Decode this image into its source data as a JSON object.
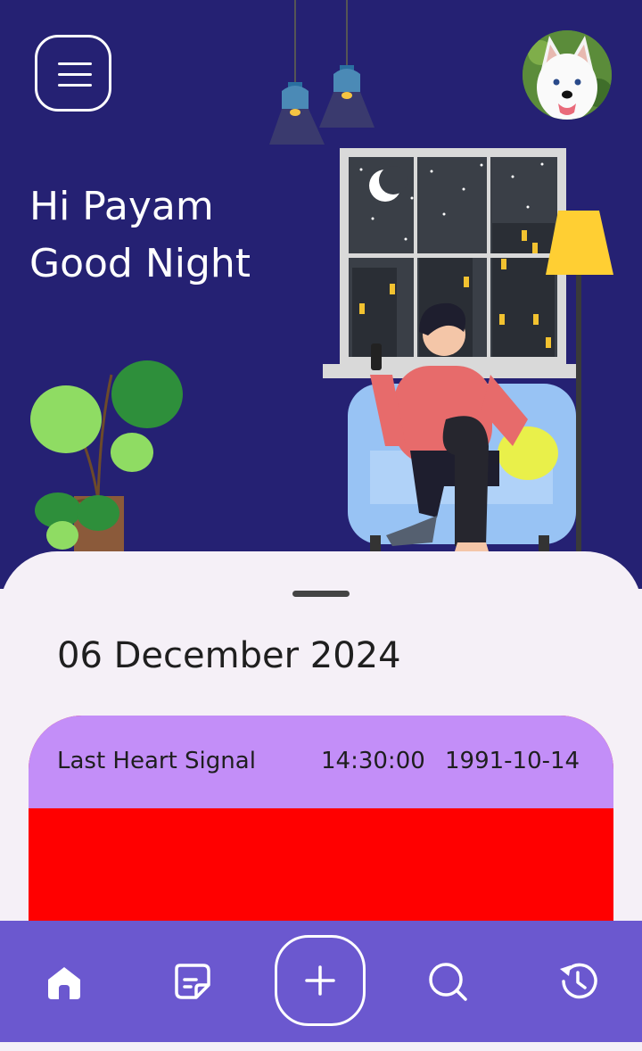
{
  "header": {
    "menu_icon": "hamburger-menu-icon",
    "avatar_icon": "profile-avatar-dog",
    "greeting_line1": "Hi Payam",
    "greeting_line2": "Good Night"
  },
  "main": {
    "date": "06 December 2024",
    "card": {
      "title": "Last Heart Signal",
      "time": "14:30:00",
      "date": "1991-10-14",
      "header_color": "#c38ef8",
      "body_color": "#ff0000"
    }
  },
  "nav": {
    "items": [
      {
        "icon": "home-icon"
      },
      {
        "icon": "note-icon"
      },
      {
        "icon": "add-icon"
      },
      {
        "icon": "search-icon"
      },
      {
        "icon": "history-icon"
      }
    ]
  },
  "colors": {
    "hero_bg": "#252173",
    "sheet_bg": "#f5f0f7",
    "nav_bg": "#6b58cf"
  }
}
